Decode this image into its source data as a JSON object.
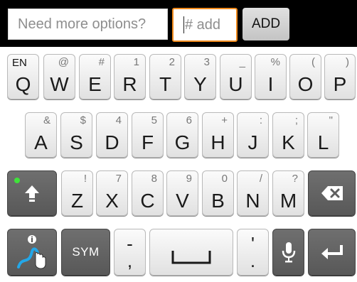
{
  "top": {
    "main_placeholder": "Need more options?",
    "add_field_value": "# add",
    "add_button_label": "ADD"
  },
  "keyboard": {
    "row1": [
      {
        "id": "q",
        "main": "Q",
        "hint": "",
        "lang": "EN"
      },
      {
        "id": "w",
        "main": "W",
        "hint": "@"
      },
      {
        "id": "e",
        "main": "E",
        "hint": "#"
      },
      {
        "id": "r",
        "main": "R",
        "hint": "1"
      },
      {
        "id": "t",
        "main": "T",
        "hint": "2"
      },
      {
        "id": "y",
        "main": "Y",
        "hint": "3"
      },
      {
        "id": "u",
        "main": "U",
        "hint": "_"
      },
      {
        "id": "i",
        "main": "I",
        "hint": "%"
      },
      {
        "id": "o",
        "main": "O",
        "hint": "("
      },
      {
        "id": "p",
        "main": "P",
        "hint": ")"
      }
    ],
    "row2": [
      {
        "id": "a",
        "main": "A",
        "hint": "&"
      },
      {
        "id": "s",
        "main": "S",
        "hint": "$"
      },
      {
        "id": "d",
        "main": "D",
        "hint": "4"
      },
      {
        "id": "f",
        "main": "F",
        "hint": "5"
      },
      {
        "id": "g",
        "main": "G",
        "hint": "6"
      },
      {
        "id": "h",
        "main": "H",
        "hint": "+"
      },
      {
        "id": "j",
        "main": "J",
        "hint": ":"
      },
      {
        "id": "k",
        "main": "K",
        "hint": ";"
      },
      {
        "id": "l",
        "main": "L",
        "hint": "\""
      }
    ],
    "row3": [
      {
        "id": "z",
        "main": "Z",
        "hint": "!"
      },
      {
        "id": "x",
        "main": "X",
        "hint": "7"
      },
      {
        "id": "c",
        "main": "C",
        "hint": "8"
      },
      {
        "id": "v",
        "main": "V",
        "hint": "9"
      },
      {
        "id": "b",
        "main": "B",
        "hint": "0"
      },
      {
        "id": "n",
        "main": "N",
        "hint": "/"
      },
      {
        "id": "m",
        "main": "M",
        "hint": "?"
      }
    ],
    "sym_label": "SYM",
    "punct_key_top": "-",
    "punct_key_bottom": ",",
    "period_key_top": "'",
    "period_key_bottom": ".",
    "accent_color": "#f08a1c",
    "shift_indicator_color": "#3fe23a"
  }
}
